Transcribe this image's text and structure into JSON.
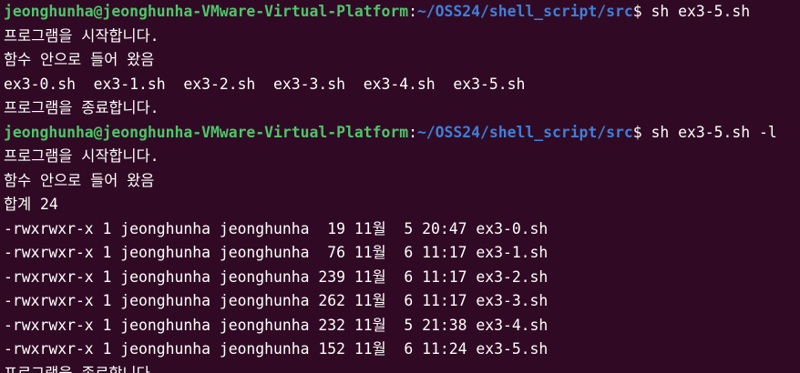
{
  "prompt": {
    "user_host": "jeonghunha@jeonghunha-VMware-Virtual-Platform",
    "sep": ":",
    "path": "~/OSS24/shell_script/src",
    "dollar": "$ "
  },
  "session1": {
    "command": "sh ex3-5.sh",
    "out1": "프로그램을 시작합니다.",
    "out2": "함수 안으로 들어 왔음",
    "out3": "ex3-0.sh  ex3-1.sh  ex3-2.sh  ex3-3.sh  ex3-4.sh  ex3-5.sh",
    "out4": "프로그램을 종료합니다."
  },
  "session2": {
    "command": "sh ex3-5.sh -l",
    "out1": "프로그램을 시작합니다.",
    "out2": "함수 안으로 들어 왔음",
    "total": "합계 24",
    "rows": [
      "-rwxrwxr-x 1 jeonghunha jeonghunha  19 11월  5 20:47 ex3-0.sh",
      "-rwxrwxr-x 1 jeonghunha jeonghunha  76 11월  6 11:17 ex3-1.sh",
      "-rwxrwxr-x 1 jeonghunha jeonghunha 239 11월  6 11:17 ex3-2.sh",
      "-rwxrwxr-x 1 jeonghunha jeonghunha 262 11월  6 11:17 ex3-3.sh",
      "-rwxrwxr-x 1 jeonghunha jeonghunha 232 11월  5 21:38 ex3-4.sh",
      "-rwxrwxr-x 1 jeonghunha jeonghunha 152 11월  6 11:24 ex3-5.sh"
    ],
    "out_end": "프로그램을 종료합니다."
  }
}
